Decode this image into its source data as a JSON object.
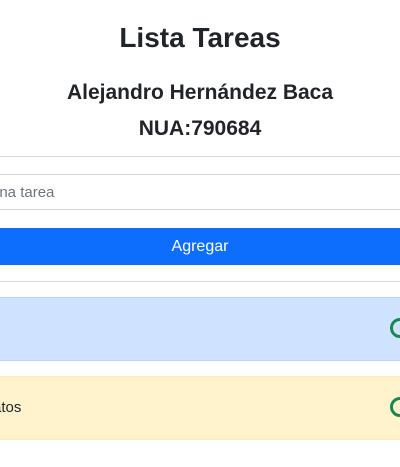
{
  "header": {
    "title": "Lista Tareas",
    "author": "Alejandro Hernández Baca",
    "nua": "NUA:790684"
  },
  "form": {
    "input_placeholder": "una tarea",
    "input_value": "",
    "add_label": "Agregar"
  },
  "tasks": [
    {
      "label": "",
      "status": "info",
      "color": "#cfe2ff"
    },
    {
      "label": "atos",
      "status": "warning",
      "color": "#fff3cd"
    }
  ],
  "colors": {
    "primary": "#0d6efd",
    "success": "#198754"
  }
}
